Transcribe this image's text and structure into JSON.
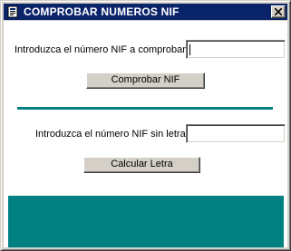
{
  "window": {
    "title": "COMPROBAR NUMEROS NIF",
    "icon": "app-window-icon",
    "close_icon": "close-icon"
  },
  "check_section": {
    "label": "Introduzca el número NIF a comprobar:",
    "input_value": "",
    "button_label": "Comprobar NIF"
  },
  "calc_section": {
    "label": "Introduzca el número NIF sin letra:",
    "input_value": "",
    "button_label": "Calcular Letra"
  },
  "colors": {
    "titlebar": "#0a246a",
    "accent": "#008080",
    "face": "#d4d0c8"
  }
}
